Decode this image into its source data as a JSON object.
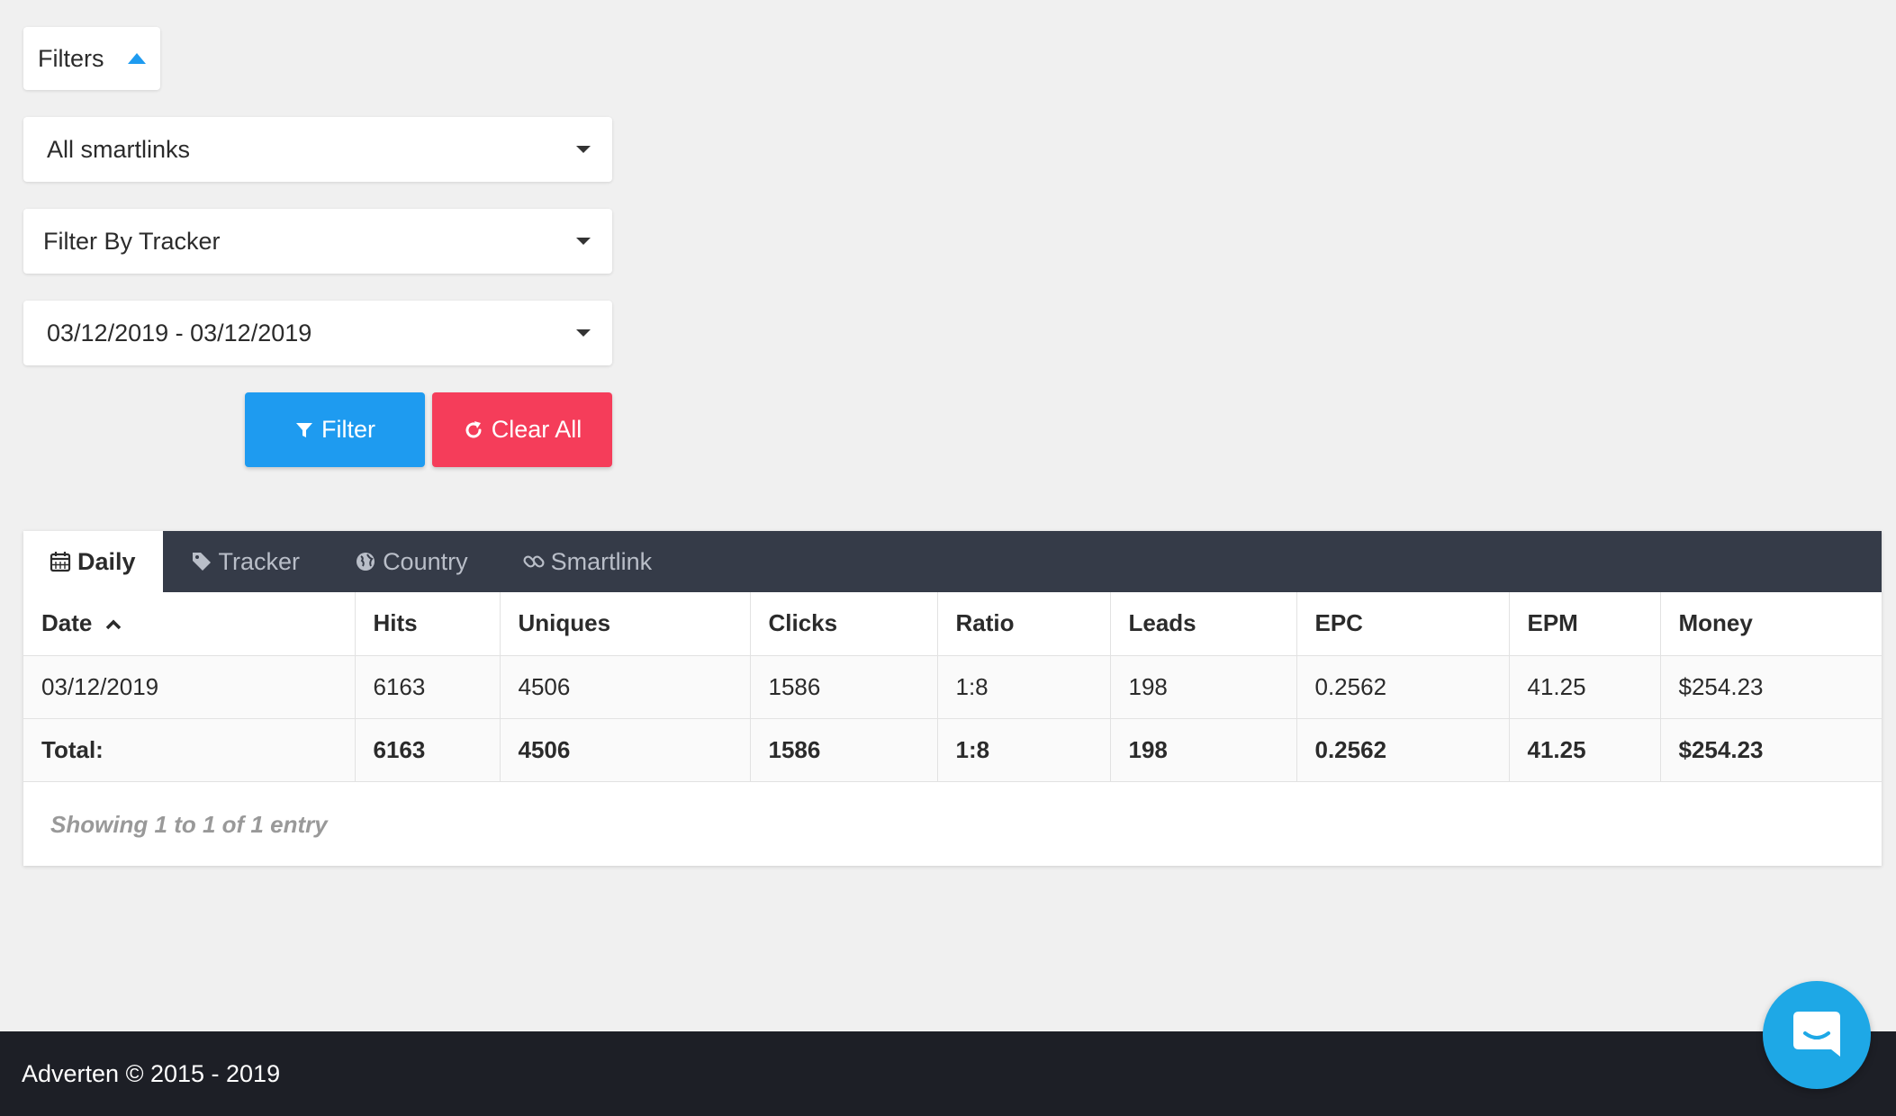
{
  "filters": {
    "toggle_label": "Filters",
    "smartlinks_select": "All smartlinks",
    "tracker_select": "Filter By Tracker",
    "date_range": "03/12/2019 - 03/12/2019",
    "filter_button": "Filter",
    "clear_button": "Clear All"
  },
  "tabs": [
    {
      "label": "Daily",
      "icon": "calendar-icon"
    },
    {
      "label": "Tracker",
      "icon": "tag-icon"
    },
    {
      "label": "Country",
      "icon": "globe-icon"
    },
    {
      "label": "Smartlink",
      "icon": "link-icon"
    }
  ],
  "table": {
    "headers": [
      "Date",
      "Hits",
      "Uniques",
      "Clicks",
      "Ratio",
      "Leads",
      "EPC",
      "EPM",
      "Money"
    ],
    "rows": [
      [
        "03/12/2019",
        "6163",
        "4506",
        "1586",
        "1:8",
        "198",
        "0.2562",
        "41.25",
        "$254.23"
      ]
    ],
    "total": [
      "Total:",
      "6163",
      "4506",
      "1586",
      "1:8",
      "198",
      "0.2562",
      "41.25",
      "$254.23"
    ]
  },
  "showing": "Showing 1 to 1 of 1 entry",
  "footer": {
    "text": "Adverten © 2015 - 2019"
  },
  "colors": {
    "primary": "#1e9bf0",
    "danger": "#f53d5a",
    "tabbar": "#353b48",
    "footer": "#1d1f26",
    "chat": "#1ea8e6"
  }
}
